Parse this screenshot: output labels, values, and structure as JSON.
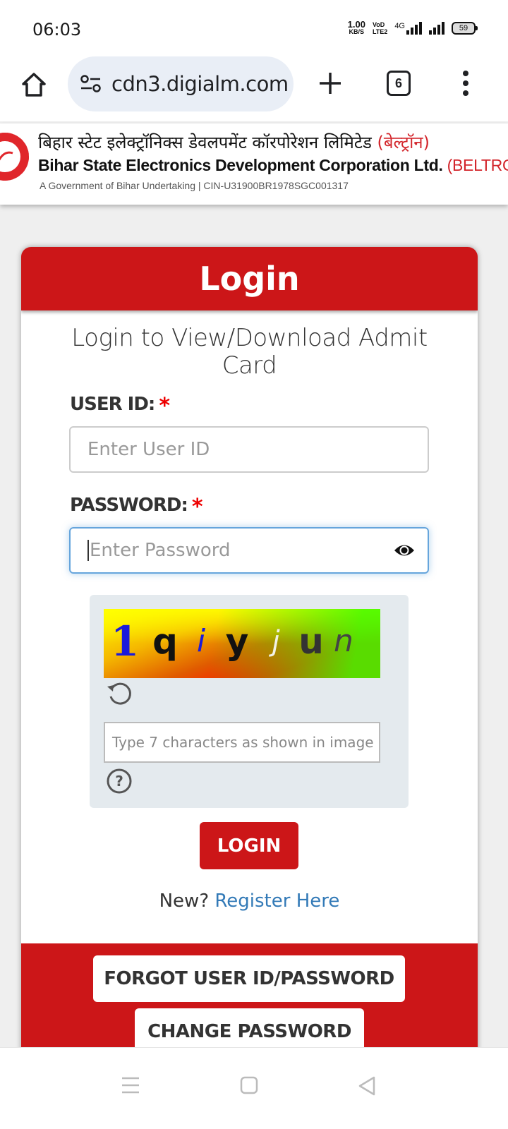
{
  "status_bar": {
    "time": "06:03",
    "net_speed_value": "1.00",
    "net_speed_unit": "KB/S",
    "volte_top": "VoD",
    "volte_bottom": "LTE2",
    "network_type": "4G",
    "battery": "59"
  },
  "browser": {
    "url": "cdn3.digialm.com",
    "tab_count": "6"
  },
  "banner": {
    "hindi_title": "बिहार स्टेट इलेक्ट्रॉनिक्स डेवलपमेंट कॉरपोरेशन लिमिटेड",
    "hindi_abbr": "(बेल्ट्रॉन)",
    "english_title": "Bihar State Electronics Development Corporation Ltd.",
    "english_abbr": "(BELTRON)",
    "subtitle": "A Government of Bihar Undertaking  |  CIN-U31900BR1978SGC001317"
  },
  "login_card": {
    "title": "Login",
    "subtitle": "Login to View/Download Admit Card",
    "user_id": {
      "label": "USER ID:",
      "required_mark": "*",
      "value": "",
      "placeholder": "Enter User ID"
    },
    "password": {
      "label": "PASSWORD:",
      "required_mark": "*",
      "value": "",
      "placeholder": "Enter Password"
    },
    "captcha": {
      "characters": [
        {
          "ch": "1",
          "color": "#1a1adb"
        },
        {
          "ch": "q",
          "color": "#111111"
        },
        {
          "ch": "i",
          "color": "#1a1adb"
        },
        {
          "ch": "y",
          "color": "#111111"
        },
        {
          "ch": "j",
          "color": "#f2f2e6"
        },
        {
          "ch": "u",
          "color": "#333333"
        },
        {
          "ch": "n",
          "color": "#444444"
        }
      ],
      "input_value": "",
      "input_placeholder": "Type 7 characters as shown in image"
    },
    "login_button": "LOGIN",
    "register_prefix": "New?",
    "register_link": "Register Here",
    "forgot_button": "FORGOT USER ID/PASSWORD",
    "change_password_button": "CHANGE PASSWORD"
  },
  "colors": {
    "brand_red": "#cc1618",
    "link_blue": "#337ab7",
    "required_red": "#ee0000"
  }
}
